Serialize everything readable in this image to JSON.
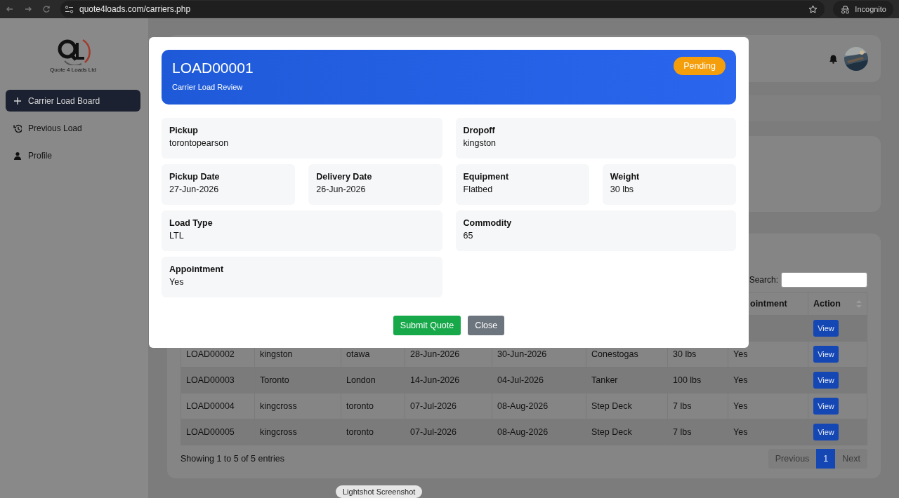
{
  "browser": {
    "url": "quote4loads.com/carriers.php",
    "profile_label": "Incognito"
  },
  "sidebar": {
    "logo_text": "Quote 4 Loads Ltd",
    "items": [
      {
        "label": "Carrier Load Board",
        "selected": true
      },
      {
        "label": "Previous Load",
        "selected": false
      },
      {
        "label": "Profile",
        "selected": false
      }
    ]
  },
  "table": {
    "search_label": "Search:",
    "columns": [
      {
        "label": "ointment"
      },
      {
        "label": "Action"
      }
    ],
    "rows": [
      {
        "action": "View"
      },
      {
        "cells": [
          "LOAD00002",
          "kingston",
          "otawa",
          "28-Jun-2026",
          "30-Jun-2026",
          "Conestogas",
          "30 lbs",
          "Yes"
        ],
        "action": "View"
      },
      {
        "cells": [
          "LOAD00003",
          "Toronto",
          "London",
          "14-Jun-2026",
          "04-Jul-2026",
          "Tanker",
          "100 lbs",
          "Yes"
        ],
        "action": "View"
      },
      {
        "cells": [
          "LOAD00004",
          "kingcross",
          "toronto",
          "07-Jul-2026",
          "08-Aug-2026",
          "Step Deck",
          "7 lbs",
          "Yes"
        ],
        "action": "View"
      },
      {
        "cells": [
          "LOAD00005",
          "kingcross",
          "toronto",
          "07-Jul-2026",
          "08-Aug-2026",
          "Step Deck",
          "7 lbs",
          "Yes"
        ],
        "action": "View"
      }
    ],
    "info": "Showing 1 to 5 of 5 entries",
    "pagination": [
      {
        "label": "Previous",
        "selected": false,
        "disabled": true
      },
      {
        "label": "1",
        "selected": true,
        "disabled": false
      },
      {
        "label": "Next",
        "selected": false,
        "disabled": true
      }
    ]
  },
  "modal": {
    "title": "LOAD00001",
    "subtitle": "Carrier Load Review",
    "status": "Pending",
    "field_rows": [
      [
        {
          "label": "Pickup",
          "value": "torontopearson"
        },
        {
          "label": "Dropoff",
          "value": "kingston"
        }
      ],
      [
        {
          "label": "Pickup Date",
          "value": "27-Jun-2026"
        },
        {
          "label": "Delivery Date",
          "value": "26-Jun-2026"
        },
        {
          "label": "Equipment",
          "value": "Flatbed"
        },
        {
          "label": "Weight",
          "value": "30 lbs"
        }
      ],
      [
        {
          "label": "Load Type",
          "value": "LTL"
        },
        {
          "label": "Commodity",
          "value": "65"
        }
      ],
      [
        {
          "label": "Appointment",
          "value": "Yes"
        }
      ]
    ],
    "buttons": [
      {
        "label": "Submit Quote",
        "kind": "primary"
      },
      {
        "label": "Close",
        "kind": "secondary"
      }
    ]
  },
  "tooltip": "Lightshot Screenshot"
}
